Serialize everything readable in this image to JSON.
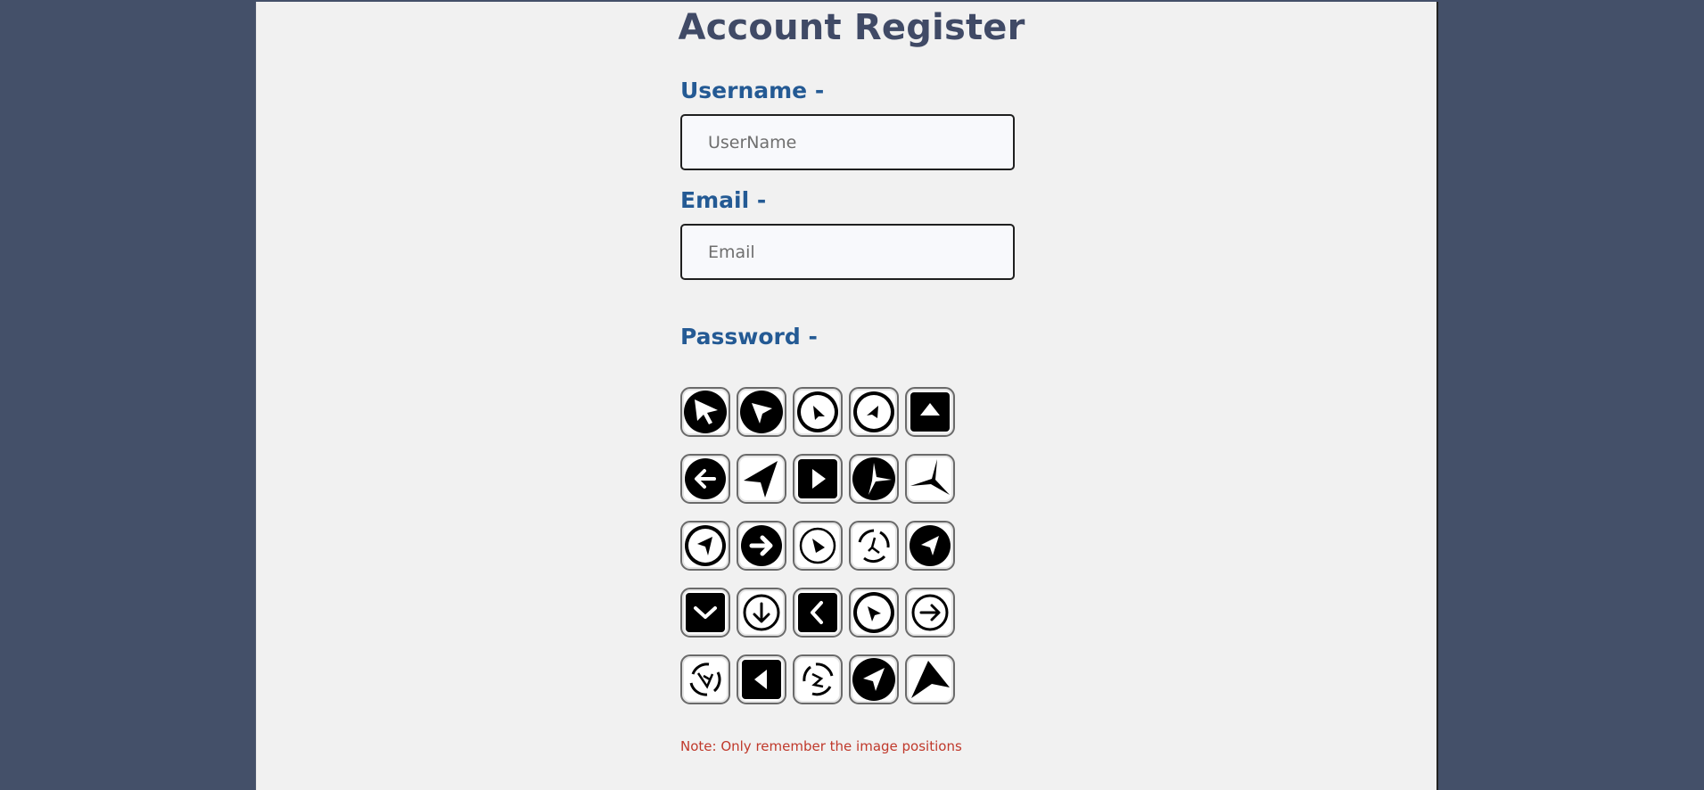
{
  "page": {
    "title": "Account Register"
  },
  "form": {
    "username_label": "Username -",
    "username_placeholder": "UserName",
    "email_label": "Email -",
    "email_placeholder": "Email",
    "password_label": "Password -",
    "note": "Note: Only remember the image positions"
  },
  "colors": {
    "background": "#445069",
    "panel": "#f1f1f1",
    "title": "#404a66",
    "label": "#245a94",
    "note": "#c0392b"
  },
  "password_grid": [
    [
      "arrow-circle-black-icon",
      "arrow-circle-black-icon",
      "arrow-circle-outline-icon",
      "arrow-circle-outline-icon",
      "triangle-up-square-icon"
    ],
    [
      "arrow-left-circle-icon",
      "navigation-arrow-icon",
      "play-square-icon",
      "compass-circle-icon",
      "navigation-arrow-icon"
    ],
    [
      "arrow-circle-outline-icon",
      "arrow-right-circle-icon",
      "play-circle-outline-icon",
      "recycle-circle-icon",
      "navigation-circle-icon"
    ],
    [
      "chevron-down-square-icon",
      "arrow-down-circle-outline-icon",
      "chevron-left-square-icon",
      "arrow-circle-outline-icon",
      "arrow-right-circle-outline-icon"
    ],
    [
      "recycle-circle-icon",
      "triangle-left-square-icon",
      "recycle-circle-icon",
      "navigation-circle-icon",
      "navigation-arrow-icon"
    ]
  ]
}
